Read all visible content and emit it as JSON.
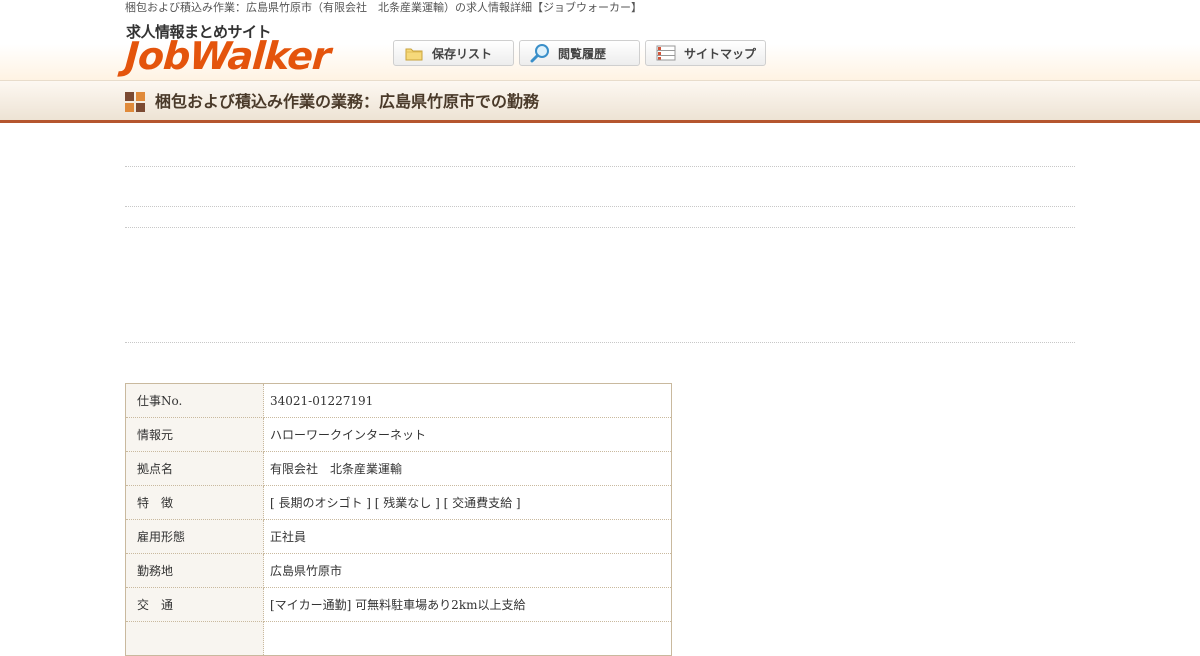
{
  "header": {
    "site_description": "梱包および積込み作業：広島県竹原市（有限会社　北条産業運輸）の求人情報詳細【ジョブウォーカー】",
    "logo_sub": "求人情報まとめサイト",
    "logo_main": "JobWalker",
    "nav": {
      "saved_list": "保存リスト",
      "history": "閲覧履歴",
      "sitemap": "サイトマップ"
    },
    "icons": [
      "folder-icon",
      "magnifier-icon",
      "list-icon"
    ],
    "accent_color": "#e4540c"
  },
  "page": {
    "title": "梱包および積込み作業の業務：広島県竹原市での勤務"
  },
  "job_table": {
    "rows": [
      {
        "label": "仕事No.",
        "value": "34021-01227191"
      },
      {
        "label": "情報元",
        "value": "ハローワークインターネット"
      },
      {
        "label": "拠点名",
        "value": "有限会社　北条産業運輸"
      },
      {
        "label": "特　徴",
        "value": "[ 長期のオシゴト ] [ 残業なし ] [ 交通費支給 ]"
      },
      {
        "label": "雇用形態",
        "value": "正社員"
      },
      {
        "label": "勤務地",
        "value": "広島県竹原市"
      },
      {
        "label": "交　通",
        "value": "[マイカー通勤] 可無料駐車場あり2km以上支給"
      }
    ]
  }
}
